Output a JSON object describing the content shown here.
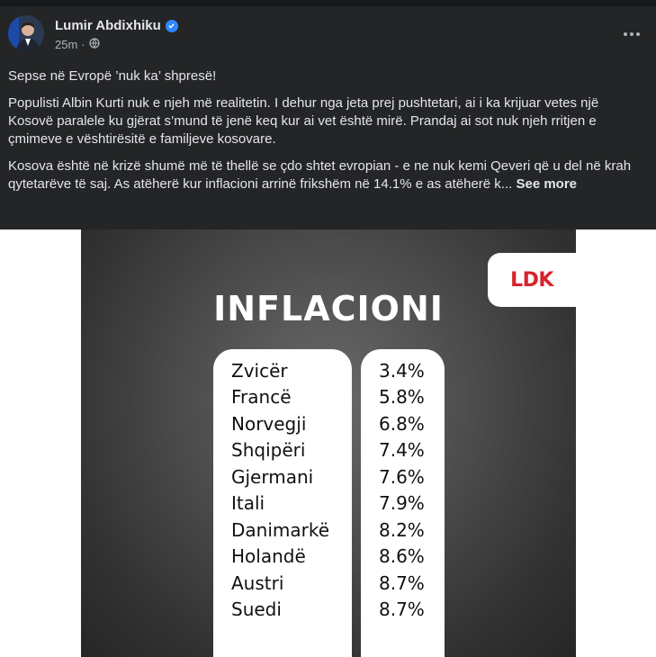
{
  "post": {
    "author": "Lumir Abdixhiku",
    "time": "25m",
    "paragraphs": [
      "Sepse në Evropë ’nuk ka’ shpresë!",
      "Populisti Albin Kurti nuk e njeh më realitetin. I dehur nga jeta prej pushtetari, ai i ka krijuar vetes një Kosovë paralele ku gjërat s’mund të jenë keq kur ai vet është mirë. Prandaj ai sot nuk njeh rritjen e çmimeve e vështirësitë e familjeve kosovare.",
      "Kosova është në krizë shumë më të thellë se çdo shtet evropian - e ne nuk kemi Qeveri që u del në krah qytetarëve të saj. As atëherë kur inflacioni arrinë frikshëm në 14.1% e as atëherë k..."
    ],
    "see_more": "See more"
  },
  "image": {
    "logo": "LDK",
    "title": "INFLACIONI",
    "rows": [
      {
        "country": "Zvicër",
        "value": "3.4%"
      },
      {
        "country": "Francë",
        "value": "5.8%"
      },
      {
        "country": "Norvegji",
        "value": "6.8%"
      },
      {
        "country": "Shqipëri",
        "value": "7.4%"
      },
      {
        "country": "Gjermani",
        "value": "7.6%"
      },
      {
        "country": "Itali",
        "value": "7.9%"
      },
      {
        "country": "Danimarkë",
        "value": "8.2%"
      },
      {
        "country": "Holandë",
        "value": "8.6%"
      },
      {
        "country": "Austri",
        "value": "8.7%"
      },
      {
        "country": "Suedi",
        "value": "8.7%"
      }
    ]
  },
  "icons": [
    "verified-badge-icon",
    "globe-icon",
    "more-options-icon"
  ],
  "colors": {
    "post_bg": "#242526",
    "accent": "#2d88ff",
    "ldk_red": "#d6242d"
  }
}
